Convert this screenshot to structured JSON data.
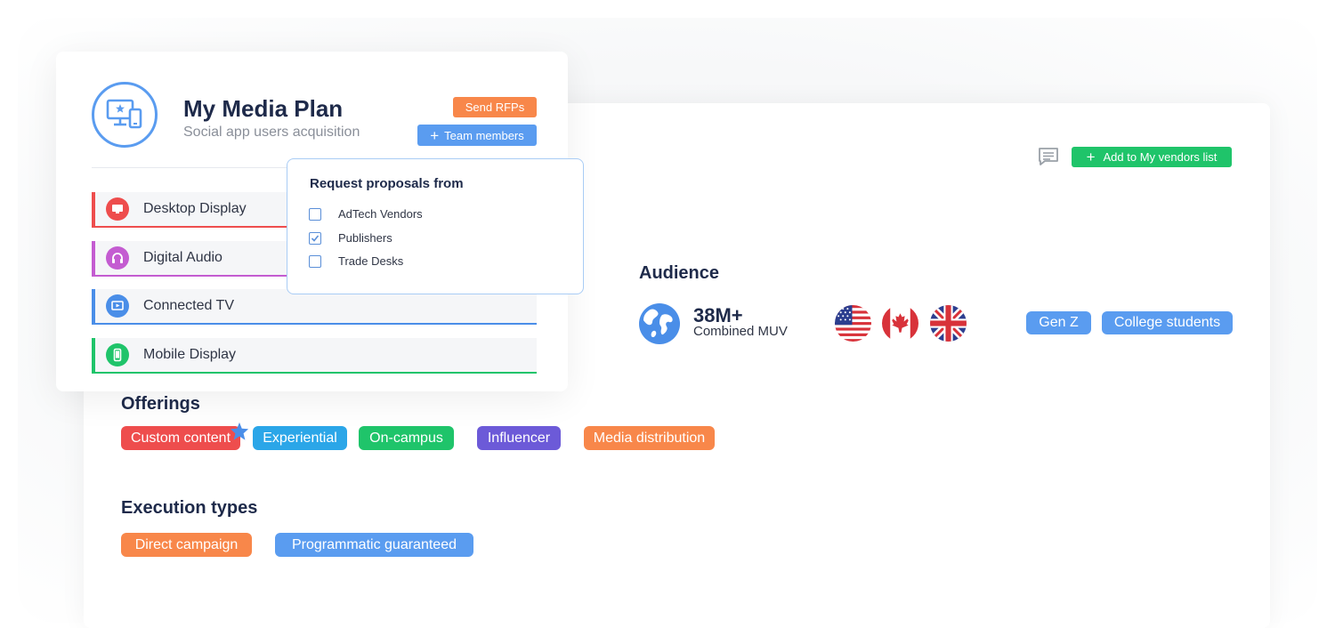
{
  "media_plan": {
    "title": "My Media Plan",
    "subtitle": "Social app users acquisition",
    "send_rfps_label": "Send RFPs",
    "team_members_label": "Team members",
    "channels": [
      {
        "label": "Desktop Display",
        "color": "#ee4d4d",
        "icon": "monitor-icon"
      },
      {
        "label": "Digital Audio",
        "color": "#c45cd1",
        "icon": "headphones-icon"
      },
      {
        "label": "Connected TV",
        "color": "#4a8ee8",
        "icon": "tv-play-icon"
      },
      {
        "label": "Mobile Display",
        "color": "#1fc46a",
        "icon": "mobile-icon"
      }
    ]
  },
  "rfp_popup": {
    "title": "Request proposals from",
    "options": [
      {
        "label": "AdTech Vendors",
        "checked": false
      },
      {
        "label": "Publishers",
        "checked": true
      },
      {
        "label": "Trade Desks",
        "checked": false
      }
    ]
  },
  "vendor": {
    "add_to_list_label": "Add to My vendors list",
    "audience": {
      "heading": "Audience",
      "muv_value": "38M+",
      "muv_label": "Combined MUV",
      "flags": [
        "us-flag-icon",
        "canada-flag-icon",
        "uk-flag-icon"
      ],
      "tags": [
        "Gen Z",
        "College students"
      ]
    },
    "offerings": {
      "heading": "Offerings",
      "tags": [
        {
          "label": "Custom content",
          "color": "#ee4d4d"
        },
        {
          "label": "Experiential",
          "color": "#2ba6e8"
        },
        {
          "label": "On-campus",
          "color": "#1fc46a"
        },
        {
          "label": "Influencer",
          "color": "#6c5ad8"
        },
        {
          "label": "Media distribution",
          "color": "#f8874a"
        }
      ]
    },
    "execution": {
      "heading": "Execution types",
      "tags": [
        {
          "label": "Direct campaign",
          "color": "#f8874a"
        },
        {
          "label": "Programmatic guaranteed",
          "color": "#5a9cf0"
        }
      ]
    }
  },
  "colors": {
    "accent_blue": "#5a9cf0",
    "accent_orange": "#f8874a",
    "accent_green": "#1fc46a",
    "heading_navy": "#1e2a4a"
  }
}
